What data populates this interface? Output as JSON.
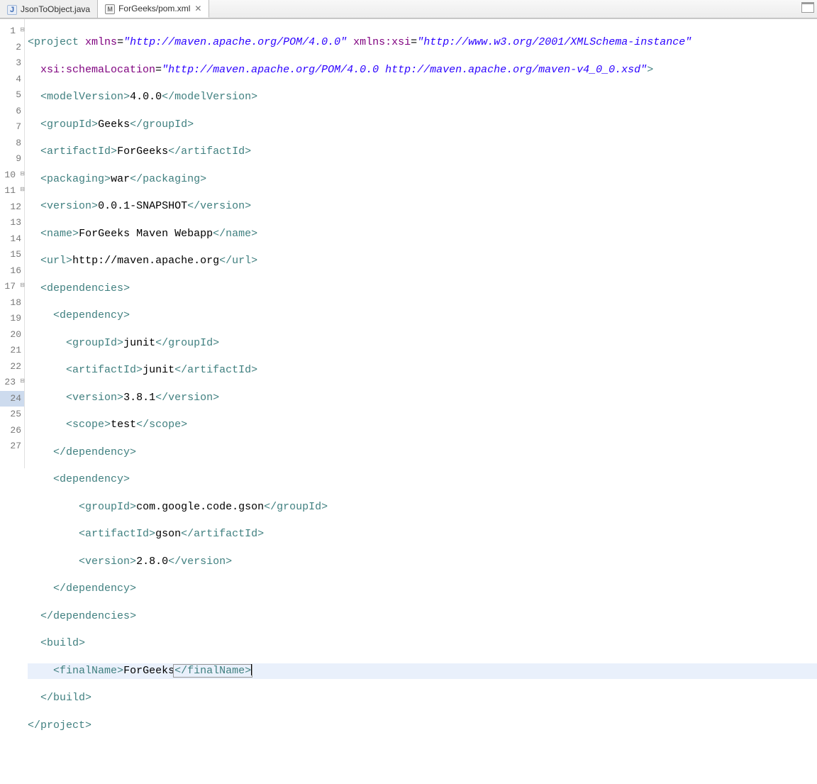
{
  "tabs": {
    "inactive": "JsonToObject.java",
    "active": "ForGeeks/pom.xml",
    "close_glyph": "✕"
  },
  "gutter": {
    "count": 27,
    "foldable": [
      1,
      10,
      11,
      17,
      23
    ],
    "current": 24
  },
  "code": {
    "l1_a": "project",
    "l1_b": "xmlns",
    "l1_c": "\"http://maven.apache.org/POM/4.0.0\"",
    "l1_d": "xmlns:xsi",
    "l1_e": "\"http://www.w3.org/2001/XMLSchema-instance\"",
    "l2_a": "xsi:schemaLocation",
    "l2_b": "\"http://maven.apache.org/POM/4.0.0 http://maven.apache.org/maven-v4_0_0.xsd\"",
    "l3_tag": "modelVersion",
    "l3_txt": "4.0.0",
    "l4_tag": "groupId",
    "l4_txt": "Geeks",
    "l5_tag": "artifactId",
    "l5_txt": "ForGeeks",
    "l6_tag": "packaging",
    "l6_txt": "war",
    "l7_tag": "version",
    "l7_txt": "0.0.1-SNAPSHOT",
    "l8_tag": "name",
    "l8_txt": "ForGeeks Maven Webapp",
    "l9_tag": "url",
    "l9_txt": "http://maven.apache.org",
    "l10_tag": "dependencies",
    "l11_tag": "dependency",
    "l12_tag": "groupId",
    "l12_txt": "junit",
    "l13_tag": "artifactId",
    "l13_txt": "junit",
    "l14_tag": "version",
    "l14_txt": "3.8.1",
    "l15_tag": "scope",
    "l15_txt": "test",
    "l16_tag": "dependency",
    "l17_tag": "dependency",
    "l18_tag": "groupId",
    "l18_txt": "com.google.code.gson",
    "l19_tag": "artifactId",
    "l19_txt": "gson",
    "l20_tag": "version",
    "l20_txt": "2.8.0",
    "l21_tag": "dependency",
    "l22_tag": "dependencies",
    "l23_tag": "build",
    "l24_tag": "finalName",
    "l24_txt": "ForGeeks",
    "l25_tag": "build",
    "l26_tag": "project"
  }
}
